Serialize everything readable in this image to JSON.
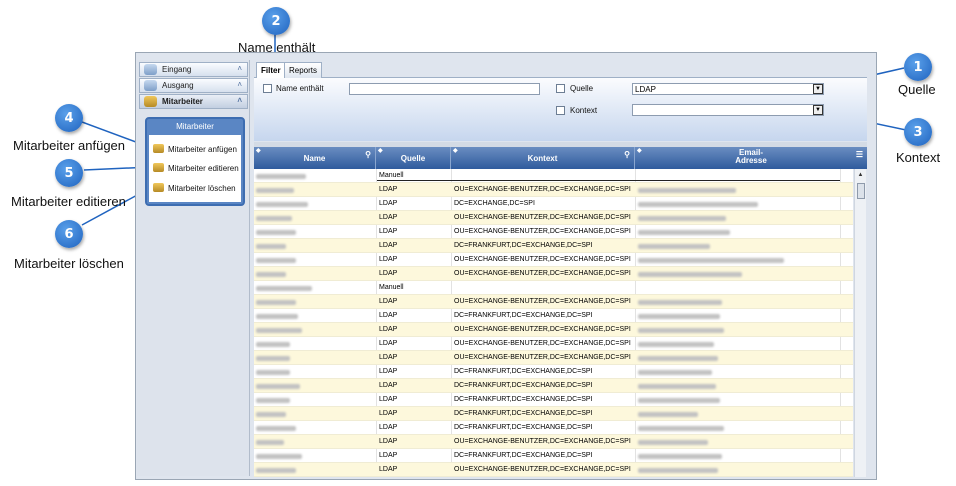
{
  "callouts": [
    {
      "num": "1",
      "label": "Quelle"
    },
    {
      "num": "2",
      "label": "Name enthält"
    },
    {
      "num": "3",
      "label": "Kontext"
    },
    {
      "num": "4",
      "label": "Mitarbeiter anfügen"
    },
    {
      "num": "5",
      "label": "Mitarbeiter editieren"
    },
    {
      "num": "6",
      "label": "Mitarbeiter löschen"
    }
  ],
  "sidebar": {
    "items": [
      {
        "label": "Eingang"
      },
      {
        "label": "Ausgang"
      },
      {
        "label": "Mitarbeiter"
      }
    ],
    "panel": {
      "title": "Mitarbeiter",
      "actions": [
        {
          "label": "Mitarbeiter anfügen"
        },
        {
          "label": "Mitarbeiter editieren"
        },
        {
          "label": "Mitarbeiter löschen"
        }
      ]
    }
  },
  "tabs": [
    {
      "label": "Filter"
    },
    {
      "label": "Reports"
    }
  ],
  "filter": {
    "name_label": "Name enthält",
    "name_value": "",
    "quelle_label": "Quelle",
    "quelle_value": "LDAP",
    "kontext_label": "Kontext",
    "kontext_value": ""
  },
  "table": {
    "columns": [
      {
        "label": "Name"
      },
      {
        "label": "Quelle"
      },
      {
        "label": "Kontext"
      },
      {
        "label": "Email-\nAdresse"
      }
    ],
    "rows": [
      {
        "quelle": "Manuell",
        "kontext": ""
      },
      {
        "quelle": "LDAP",
        "kontext": "OU=EXCHANGE-BENUTZER,DC=EXCHANGE,DC=SPI"
      },
      {
        "quelle": "LDAP",
        "kontext": "DC=EXCHANGE,DC=SPI"
      },
      {
        "quelle": "LDAP",
        "kontext": "OU=EXCHANGE-BENUTZER,DC=EXCHANGE,DC=SPI"
      },
      {
        "quelle": "LDAP",
        "kontext": "OU=EXCHANGE-BENUTZER,DC=EXCHANGE,DC=SPI"
      },
      {
        "quelle": "LDAP",
        "kontext": "DC=FRANKFURT,DC=EXCHANGE,DC=SPI"
      },
      {
        "quelle": "LDAP",
        "kontext": "OU=EXCHANGE-BENUTZER,DC=EXCHANGE,DC=SPI"
      },
      {
        "quelle": "LDAP",
        "kontext": "OU=EXCHANGE-BENUTZER,DC=EXCHANGE,DC=SPI"
      },
      {
        "quelle": "Manuell",
        "kontext": ""
      },
      {
        "quelle": "LDAP",
        "kontext": "OU=EXCHANGE-BENUTZER,DC=EXCHANGE,DC=SPI"
      },
      {
        "quelle": "LDAP",
        "kontext": "DC=FRANKFURT,DC=EXCHANGE,DC=SPI"
      },
      {
        "quelle": "LDAP",
        "kontext": "OU=EXCHANGE-BENUTZER,DC=EXCHANGE,DC=SPI"
      },
      {
        "quelle": "LDAP",
        "kontext": "OU=EXCHANGE-BENUTZER,DC=EXCHANGE,DC=SPI"
      },
      {
        "quelle": "LDAP",
        "kontext": "OU=EXCHANGE-BENUTZER,DC=EXCHANGE,DC=SPI"
      },
      {
        "quelle": "LDAP",
        "kontext": "DC=FRANKFURT,DC=EXCHANGE,DC=SPI"
      },
      {
        "quelle": "LDAP",
        "kontext": "DC=FRANKFURT,DC=EXCHANGE,DC=SPI"
      },
      {
        "quelle": "LDAP",
        "kontext": "DC=FRANKFURT,DC=EXCHANGE,DC=SPI"
      },
      {
        "quelle": "LDAP",
        "kontext": "DC=FRANKFURT,DC=EXCHANGE,DC=SPI"
      },
      {
        "quelle": "LDAP",
        "kontext": "DC=FRANKFURT,DC=EXCHANGE,DC=SPI"
      },
      {
        "quelle": "LDAP",
        "kontext": "OU=EXCHANGE-BENUTZER,DC=EXCHANGE,DC=SPI"
      },
      {
        "quelle": "LDAP",
        "kontext": "DC=FRANKFURT,DC=EXCHANGE,DC=SPI"
      },
      {
        "quelle": "LDAP",
        "kontext": "OU=EXCHANGE-BENUTZER,DC=EXCHANGE,DC=SPI"
      },
      {
        "quelle": "LDAP",
        "kontext": "DC=FRANKFURT,DC=EXCHANGE,DC=SPI"
      }
    ]
  },
  "colors": {
    "callout": "#2a6fd1",
    "header": "#3b65a6",
    "row_alt": "#fdf8dc"
  }
}
